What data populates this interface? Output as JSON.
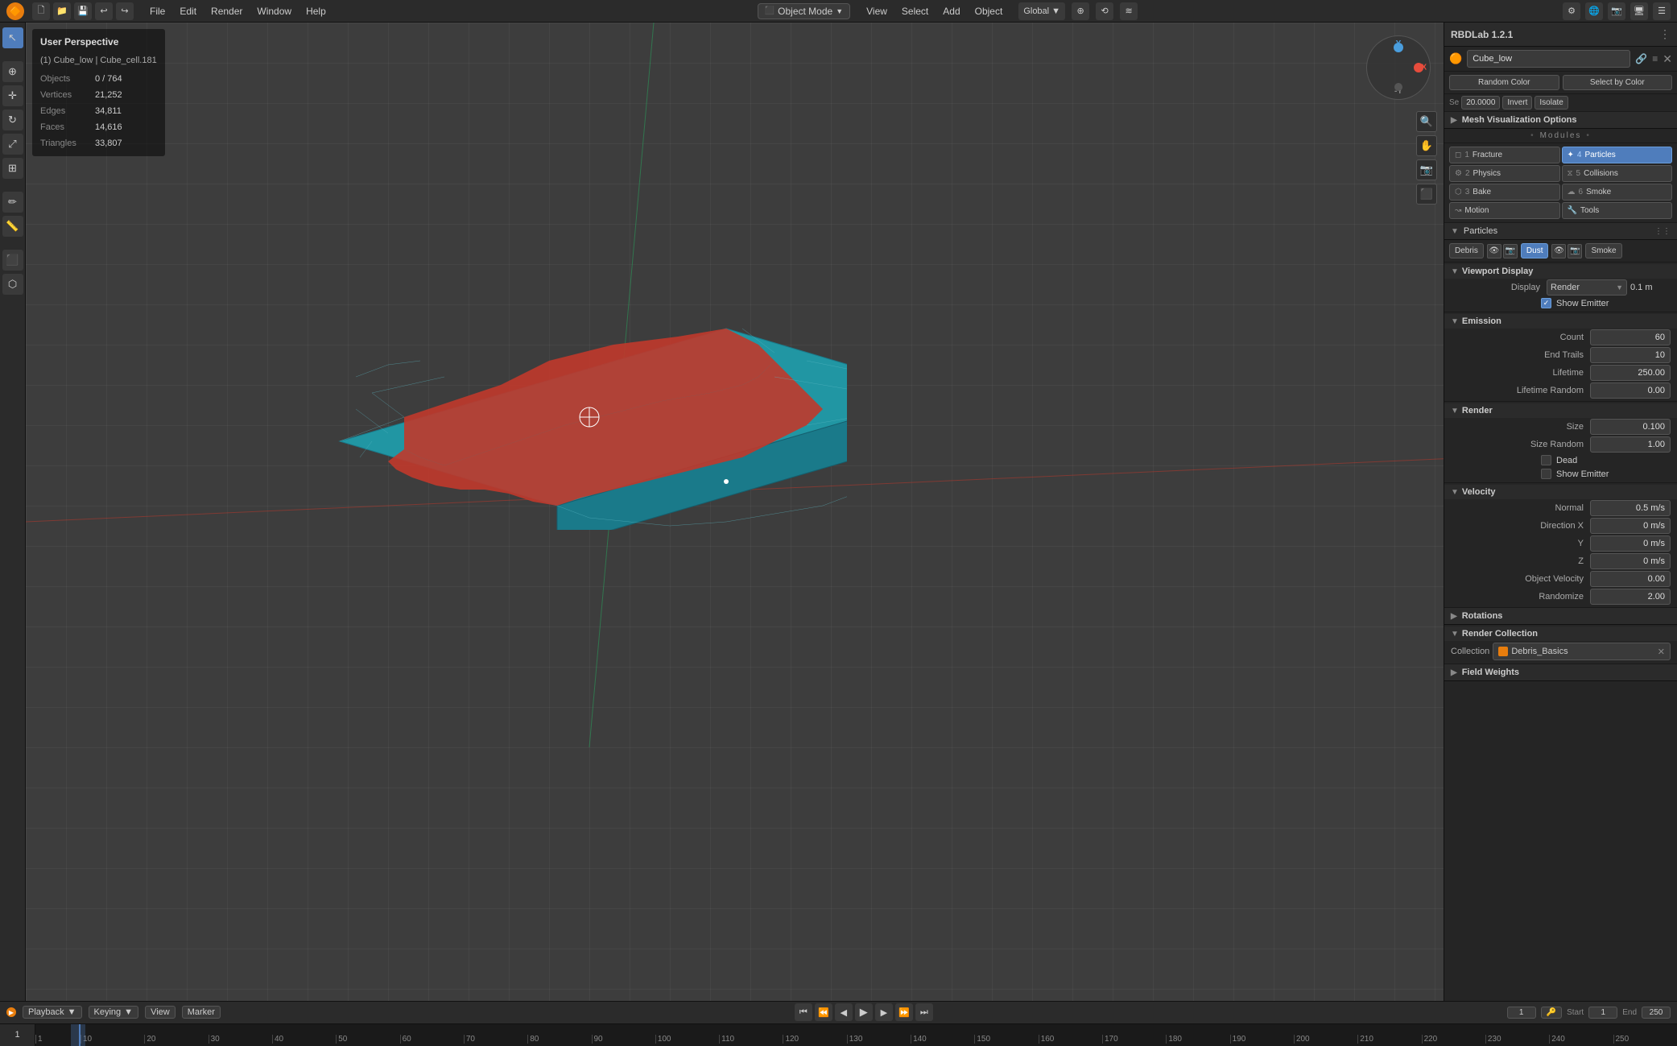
{
  "app": {
    "title": "Blender",
    "mode": "Object Mode",
    "panel_title": "RBDLab 1.2.1"
  },
  "top_menu": {
    "items": [
      "File",
      "Edit",
      "Render",
      "Window",
      "Help"
    ],
    "view_menu": [
      "File",
      "Edit",
      "View",
      "Select",
      "Add",
      "Object"
    ]
  },
  "viewport": {
    "title": "User Perspective",
    "subtitle": "(1) Cube_low | Cube_cell.181",
    "objects": "0 / 764",
    "vertices": "21,252",
    "edges": "34,811",
    "faces": "14,616",
    "triangles": "33,807"
  },
  "rbdlab": {
    "title": "RBDLab 1.2.1",
    "object_name": "Cube_low",
    "buttons": {
      "random_color": "Random Color",
      "select_by_color": "Select by Color",
      "se_value": "20.0000",
      "invert": "Invert",
      "isolate": "Isolate"
    },
    "mesh_vis": "Mesh Visualization Options",
    "modules_label": "• Modules •",
    "modules": [
      {
        "num": "1",
        "label": "Fracture",
        "active": false
      },
      {
        "num": "4",
        "label": "Particles",
        "active": true
      },
      {
        "num": "2",
        "label": "Physics",
        "active": false
      },
      {
        "num": "5",
        "label": "Collisions",
        "active": false
      },
      {
        "num": "3",
        "label": "Bake",
        "active": false
      },
      {
        "num": "6",
        "label": "Smoke",
        "active": false
      },
      {
        "num": "",
        "label": "Motion",
        "active": false
      },
      {
        "num": "",
        "label": "Tools",
        "active": false
      }
    ],
    "particles": {
      "section_title": "Particles",
      "tabs": [
        "Debris",
        "Dust",
        "Smoke"
      ],
      "active_tab": "Dust",
      "viewport_display": {
        "title": "Viewport Display",
        "display": "Render",
        "value": "0.1 m",
        "show_emitter": true,
        "show_emitter_label": "Show Emitter"
      },
      "emission": {
        "title": "Emission",
        "count": "60",
        "end_trails": "10",
        "lifetime": "250.00",
        "lifetime_random": "0.00"
      },
      "render": {
        "title": "Render",
        "size": "0.100",
        "size_random": "1.00",
        "dead": false,
        "dead_label": "Dead",
        "show_emitter": false,
        "show_emitter_label": "Show Emitter"
      },
      "velocity": {
        "title": "Velocity",
        "normal": "0.5 m/s",
        "direction_x": "0 m/s",
        "direction_y": "0 m/s",
        "direction_z": "0 m/s",
        "object_velocity": "0.00",
        "randomize": "2.00"
      },
      "rotations": {
        "title": "Rotations",
        "collapsed": true
      },
      "render_collection": {
        "title": "Render Collection",
        "collection_label": "Collection",
        "collection_name": "Debris_Basics"
      },
      "field_weights": {
        "title": "Field Weights",
        "collapsed": true
      }
    }
  },
  "timeline": {
    "playback_label": "Playback",
    "keying_label": "Keying",
    "view_label": "View",
    "marker_label": "Marker",
    "frame_current": "1",
    "start": "1",
    "end": "250",
    "frame_ticks": [
      "1",
      "10",
      "20",
      "30",
      "40",
      "50",
      "60",
      "70",
      "80",
      "90",
      "100",
      "110",
      "120",
      "130",
      "140",
      "150",
      "160",
      "170",
      "180",
      "190",
      "200",
      "210",
      "220",
      "230",
      "240",
      "250"
    ]
  }
}
